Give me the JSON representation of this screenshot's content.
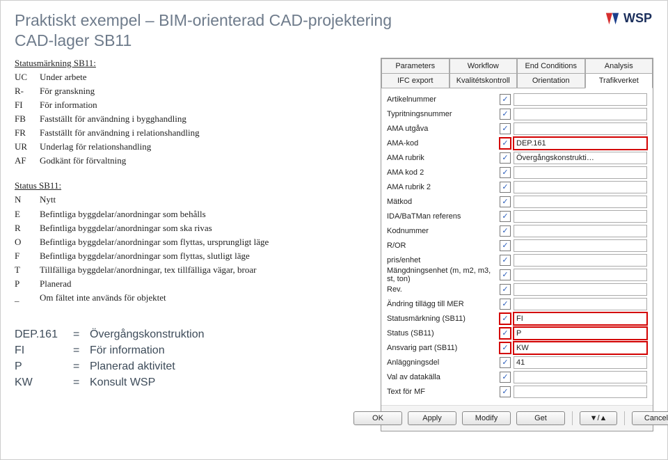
{
  "title_line1": "Praktiskt exempel – BIM-orienterad CAD-projektering",
  "title_line2": "CAD-lager SB11",
  "logo_text": "WSP",
  "statusmarkning": {
    "header": "Statusmärkning SB11:",
    "items": [
      {
        "k": "UC",
        "v": "Under arbete"
      },
      {
        "k": "R-",
        "v": "För granskning"
      },
      {
        "k": "FI",
        "v": "För information"
      },
      {
        "k": "FB",
        "v": "Fastställt för användning i bygghandling"
      },
      {
        "k": "FR",
        "v": "Fastställt för användning i relationshandling"
      },
      {
        "k": "UR",
        "v": "Underlag för relationshandling"
      },
      {
        "k": "AF",
        "v": "Godkänt för förvaltning"
      }
    ]
  },
  "status": {
    "header": "Status SB11:",
    "items": [
      {
        "k": "N",
        "v": "Nytt"
      },
      {
        "k": "E",
        "v": "Befintliga byggdelar/anordningar som behålls"
      },
      {
        "k": "R",
        "v": "Befintliga byggdelar/anordningar som ska rivas"
      },
      {
        "k": "O",
        "v": "Befintliga byggdelar/anordningar som flyttas, ursprungligt läge"
      },
      {
        "k": "F",
        "v": "Befintliga byggdelar/anordningar som flyttas, slutligt läge"
      },
      {
        "k": "T",
        "v": "Tillfälliga byggdelar/anordningar, tex tillfälliga vägar, broar"
      },
      {
        "k": "P",
        "v": "Planerad"
      },
      {
        "k": "_",
        "v": "Om fältet inte används för objektet"
      }
    ]
  },
  "legend": [
    {
      "k": "DEP.161",
      "v": "Övergångskonstruktion"
    },
    {
      "k": "FI",
      "v": "För information"
    },
    {
      "k": "P",
      "v": "Planerad aktivitet"
    },
    {
      "k": "KW",
      "v": "Konsult WSP"
    }
  ],
  "dialog": {
    "tabs_row1": [
      "Parameters",
      "Workflow",
      "End Conditions",
      "Analysis"
    ],
    "tabs_row2": [
      "IFC export",
      "Kvalitétskontroll",
      "Orientation",
      "Trafikverket"
    ],
    "active_tab": "Trafikverket",
    "fields": [
      {
        "label": "Artikelnummer",
        "checked": true,
        "value": "",
        "hi": false
      },
      {
        "label": "Typritningsnummer",
        "checked": true,
        "value": "",
        "hi": false
      },
      {
        "label": "AMA utgåva",
        "checked": true,
        "value": "",
        "hi": false
      },
      {
        "label": "AMA-kod",
        "checked": true,
        "value": "DEP.161",
        "hi": true
      },
      {
        "label": "AMA rubrik",
        "checked": true,
        "value": "Övergångskonstrukti…",
        "hi": false
      },
      {
        "label": "AMA kod 2",
        "checked": true,
        "value": "",
        "hi": false
      },
      {
        "label": "AMA rubrik 2",
        "checked": true,
        "value": "",
        "hi": false
      },
      {
        "label": "Mätkod",
        "checked": true,
        "value": "",
        "hi": false
      },
      {
        "label": "IDA/BaTMan referens",
        "checked": true,
        "value": "",
        "hi": false
      },
      {
        "label": "Kodnummer",
        "checked": true,
        "value": "",
        "hi": false
      },
      {
        "label": "R/OR",
        "checked": true,
        "value": "",
        "hi": false
      },
      {
        "label": "pris/enhet",
        "checked": true,
        "value": "",
        "hi": false
      },
      {
        "label": "Mängdningsenhet (m, m2, m3, st, ton)",
        "checked": true,
        "value": "",
        "hi": false
      },
      {
        "label": "Rev.",
        "checked": true,
        "value": "",
        "hi": false
      },
      {
        "label": "Ändring tillägg till MER",
        "checked": true,
        "value": "",
        "hi": false
      },
      {
        "label": "Statusmärkning (SB11)",
        "checked": true,
        "value": "FI",
        "hi": true
      },
      {
        "label": "Status (SB11)",
        "checked": true,
        "value": "P",
        "hi": true
      },
      {
        "label": "Ansvarig part (SB11)",
        "checked": true,
        "value": "KW",
        "hi": true
      },
      {
        "label": "Anläggningsdel",
        "checked": true,
        "value": "41",
        "hi": false
      },
      {
        "label": "Val av datakälla",
        "checked": true,
        "value": "",
        "hi": false
      },
      {
        "label": "Text för MF",
        "checked": true,
        "value": "",
        "hi": false
      }
    ],
    "buttons": {
      "ok": "OK",
      "apply": "Apply",
      "modify": "Modify",
      "get": "Get",
      "cancel": "Cancel"
    }
  }
}
